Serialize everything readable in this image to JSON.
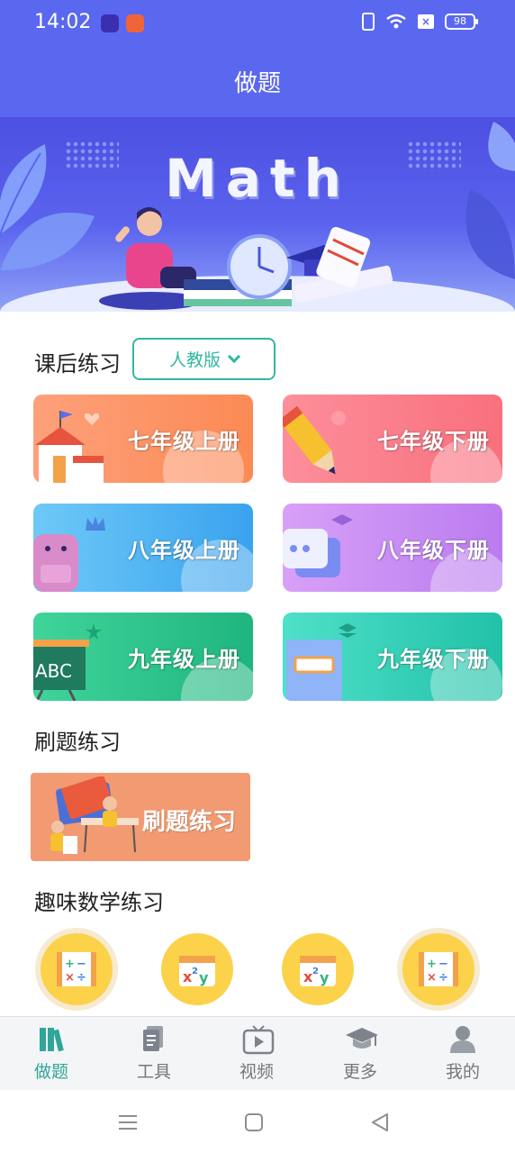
{
  "status": {
    "time": "14:02",
    "battery": "98"
  },
  "header": {
    "title": "做题"
  },
  "banner": {
    "title": "Math"
  },
  "after_class": {
    "title": "课后练习",
    "edition": "人教版",
    "grades": [
      {
        "label": "七年级上册"
      },
      {
        "label": "七年级下册"
      },
      {
        "label": "八年级上册"
      },
      {
        "label": "八年级下册"
      },
      {
        "label": "九年级上册"
      },
      {
        "label": "九年级下册"
      }
    ]
  },
  "drill": {
    "title": "刷题练习",
    "card_label": "刷题练习"
  },
  "fun_math": {
    "title": "趣味数学练习"
  },
  "tabbar": {
    "items": [
      {
        "label": "做题",
        "icon": "books-icon"
      },
      {
        "label": "工具",
        "icon": "clipboard-icon"
      },
      {
        "label": "视频",
        "icon": "tv-play-icon"
      },
      {
        "label": "更多",
        "icon": "graduation-cap-icon"
      },
      {
        "label": "我的",
        "icon": "person-icon"
      }
    ]
  },
  "colors": {
    "header": "#5a68f0",
    "accent": "#2fb8a0",
    "tab_active": "#2fa697"
  }
}
